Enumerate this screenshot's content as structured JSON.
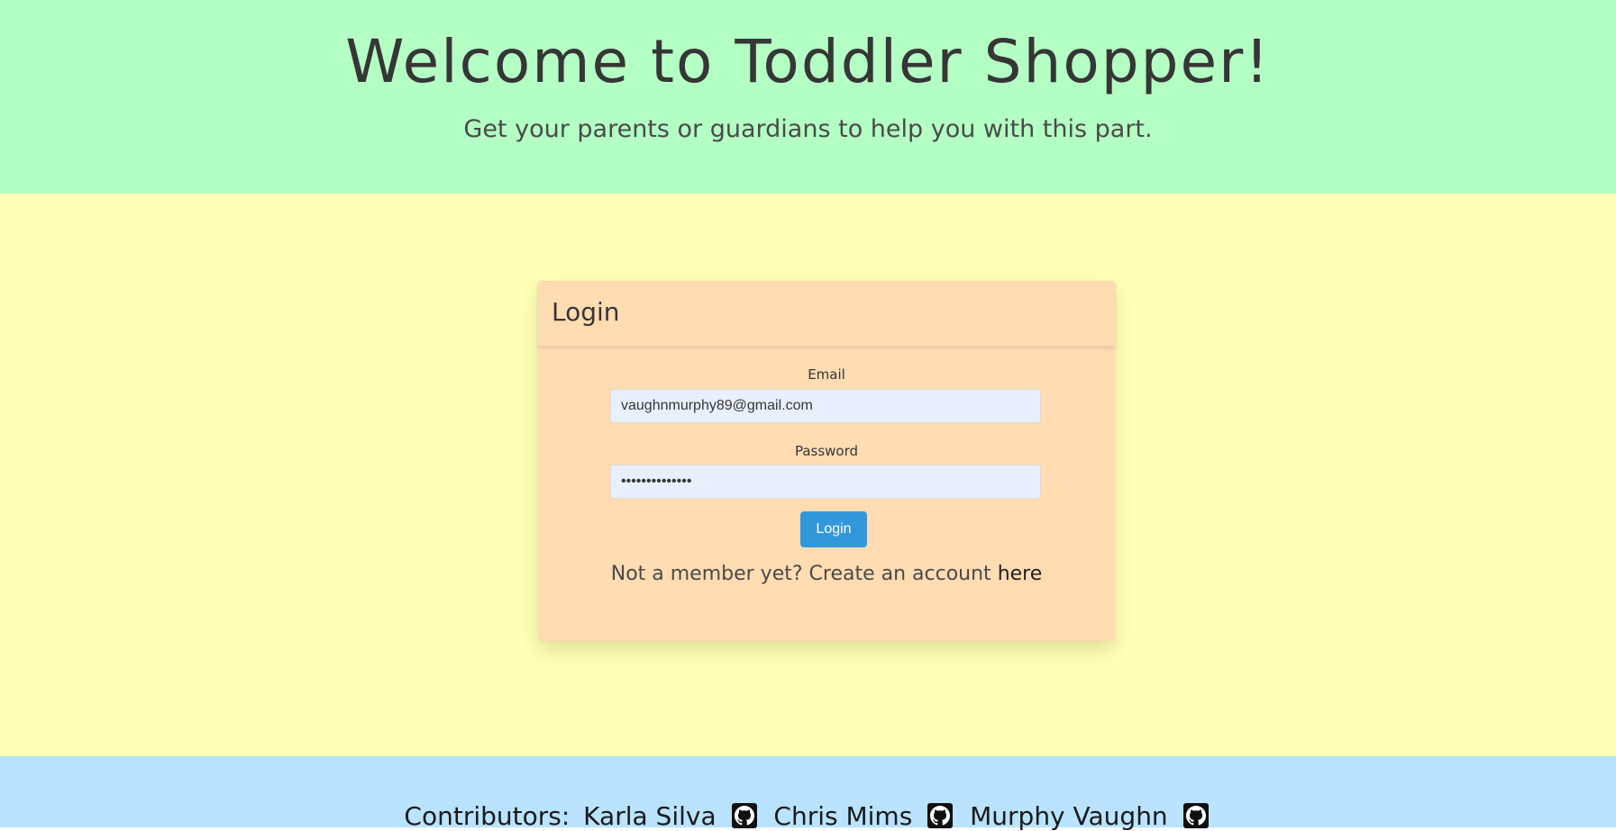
{
  "hero": {
    "title": "Welcome to Toddler Shopper!",
    "subtitle": "Get your parents or guardians to help you with this part."
  },
  "login_card": {
    "header": "Login",
    "email_label": "Email",
    "email_value": "vaughnmurphy89@gmail.com",
    "password_label": "Password",
    "password_value": "••••••••••••••",
    "login_button": "Login",
    "signup_prompt": "Not a member yet? Create an account",
    "signup_link": "here"
  },
  "footer": {
    "contributors_label": "Contributors:",
    "contributors": [
      {
        "name": "Karla Silva",
        "icon": "github-icon"
      },
      {
        "name": "Chris Mims",
        "icon": "github-icon"
      },
      {
        "name": "Murphy Vaughn",
        "icon": "github-icon"
      }
    ]
  },
  "colors": {
    "hero_bg": "#b4ffc4",
    "main_bg": "#ffffb5",
    "card_bg": "#ffdcb2",
    "footer_bg": "#b9e3ff",
    "button_bg": "#3298dc",
    "input_bg": "#e8f0fe"
  }
}
